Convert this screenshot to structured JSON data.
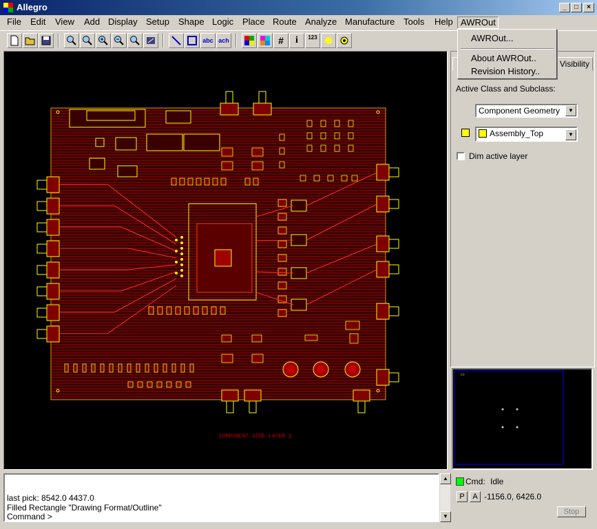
{
  "window": {
    "title": "Allegro"
  },
  "menubar": {
    "items": [
      "File",
      "Edit",
      "View",
      "Add",
      "Display",
      "Setup",
      "Shape",
      "Logic",
      "Place",
      "Route",
      "Analyze",
      "Manufacture",
      "Tools",
      "Help",
      "AWROut"
    ]
  },
  "awrout_menu": {
    "items": [
      "AWROut...",
      "About AWROut..",
      "Revision History.."
    ]
  },
  "toolbar": {
    "icons": [
      "new-file-icon",
      "open-file-icon",
      "save-icon",
      "zoom-points-icon",
      "zoom-fit-icon",
      "zoom-in-icon",
      "zoom-out-icon",
      "zoom-world-icon",
      "redraw-icon",
      "add-line-icon",
      "add-rect-icon",
      "add-text-icon",
      "edit-text-icon",
      "color-icon",
      "layer-visibility-icon",
      "grid-icon",
      "info-icon",
      "measure-icon",
      "highlight-icon",
      "dehighlight-icon"
    ],
    "text_glyphs": {
      "add_text": "abc",
      "edit_text": "ach",
      "measure": "123"
    }
  },
  "panel": {
    "tab_label": "Visibility",
    "active_class_label": "Active Class and Subclass:",
    "class_value": "Component Geometry",
    "subclass_value": "Assembly_Top",
    "subclass_color": "#ffff00",
    "dim_active_layer_label": "Dim active layer",
    "dim_active_layer_checked": false
  },
  "canvas": {
    "background": "#000000",
    "board_color": "#8b0000",
    "outline_color": "#ffff00",
    "layer_label": "COMPONENT SIDE LAYER 1"
  },
  "console": {
    "lines": [
      "last pick:  8542.0  4437.0",
      "Filled Rectangle \"Drawing Format/Outline\"",
      "Command >"
    ]
  },
  "status": {
    "cmd_label": "Cmd:",
    "cmd_state": "Idle",
    "p_button": "P",
    "a_button": "A",
    "coordinates": "-1156.0, 6426.0",
    "stop_label": "Stop",
    "led_color": "#00ff00"
  }
}
